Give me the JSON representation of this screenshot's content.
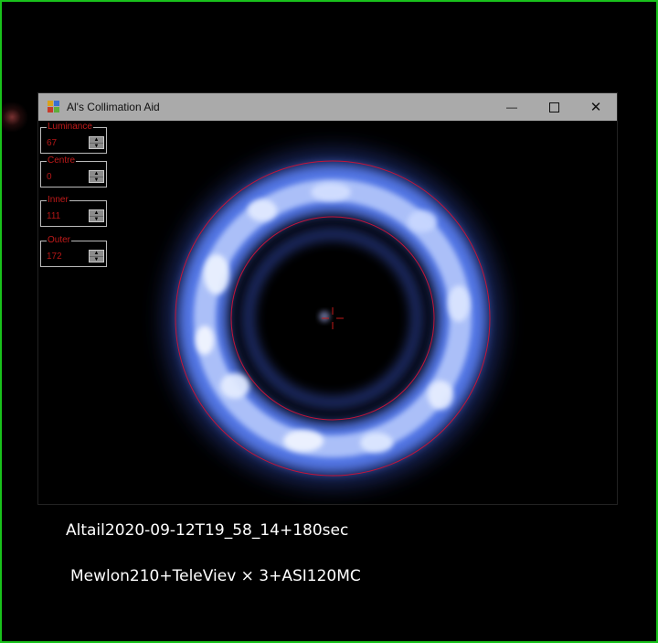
{
  "window": {
    "title": "Al's Collimation Aid",
    "minimize_glyph": "—",
    "close_glyph": "✕"
  },
  "controls": [
    {
      "label": "Luminance",
      "value": "67"
    },
    {
      "label": "Centre",
      "value": "0"
    },
    {
      "label": "Inner",
      "value": "111"
    },
    {
      "label": "Outer",
      "value": "172"
    }
  ],
  "spinner": {
    "up_glyph": "▲",
    "down_glyph": "▼"
  },
  "captions": {
    "line1": "Altail2020-09-12T19_58_14+180sec",
    "line2": "Mewlon210+TeleViev × 3+ASI120MC"
  },
  "colors": {
    "frame": "#19c21c",
    "circle": "#c2143a",
    "crosshair": "#c21a1a",
    "ring_glow": "#7fa8ff",
    "titlebar": "#aaaaaa"
  },
  "icons": [
    "app-icon",
    "minimize-icon",
    "maximize-icon",
    "close-icon",
    "crosshair-icon"
  ]
}
